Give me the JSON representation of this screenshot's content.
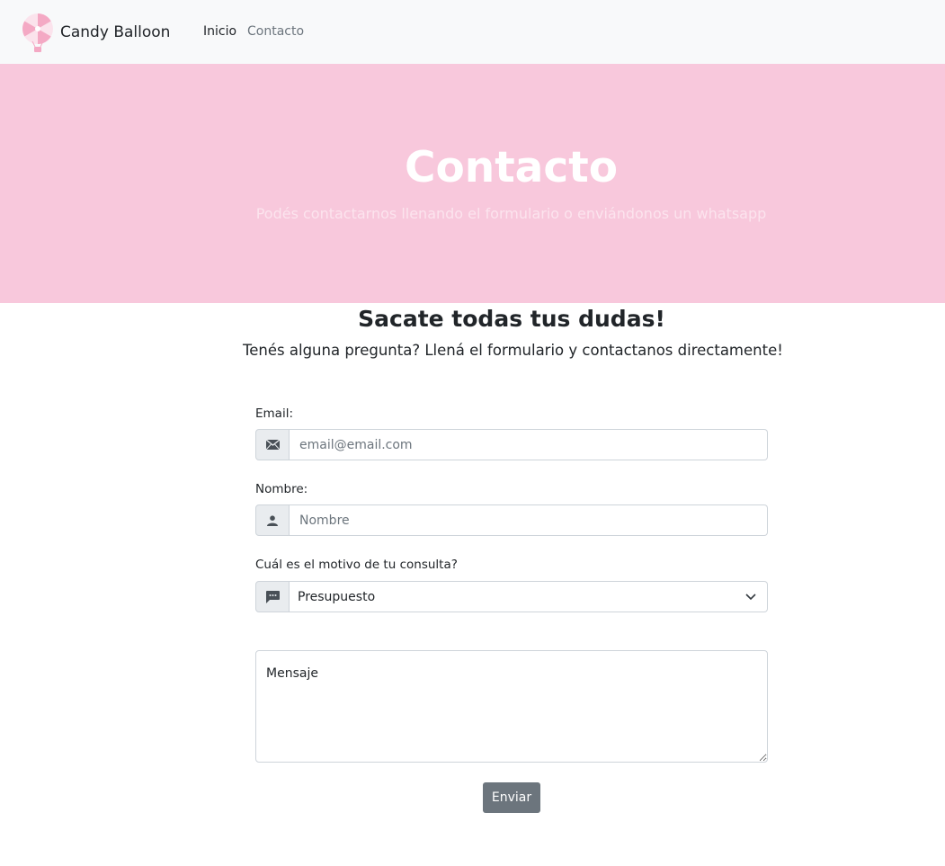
{
  "navbar": {
    "brand_name": "Candy Balloon",
    "logo_icon": "candy-balloon-logo",
    "links": [
      {
        "label": "Inicio",
        "active": true
      },
      {
        "label": "Contacto",
        "active": false
      }
    ]
  },
  "hero": {
    "title": "Contacto",
    "subtitle": "Podés contactarnos llenando el formulario o enviándonos un whatsapp"
  },
  "section": {
    "title": "Sacate todas tus dudas!",
    "lead": "Tenés alguna pregunta? Llená el formulario y contactanos directamente!"
  },
  "form": {
    "email": {
      "label": "Email:",
      "placeholder": "email@email.com",
      "icon": "envelope-icon"
    },
    "name": {
      "label": "Nombre:",
      "placeholder": "Nombre",
      "icon": "person-icon"
    },
    "reason": {
      "label": "Cuál es el motivo de tu consulta?",
      "selected": "Presupuesto",
      "icon": "chat-icon"
    },
    "message": {
      "placeholder": "Mensaje"
    },
    "submit_label": "Enviar"
  },
  "colors": {
    "hero_bg": "#f8c8dc",
    "navbar_bg": "#f8f9fa",
    "button_bg": "#6c757d"
  }
}
